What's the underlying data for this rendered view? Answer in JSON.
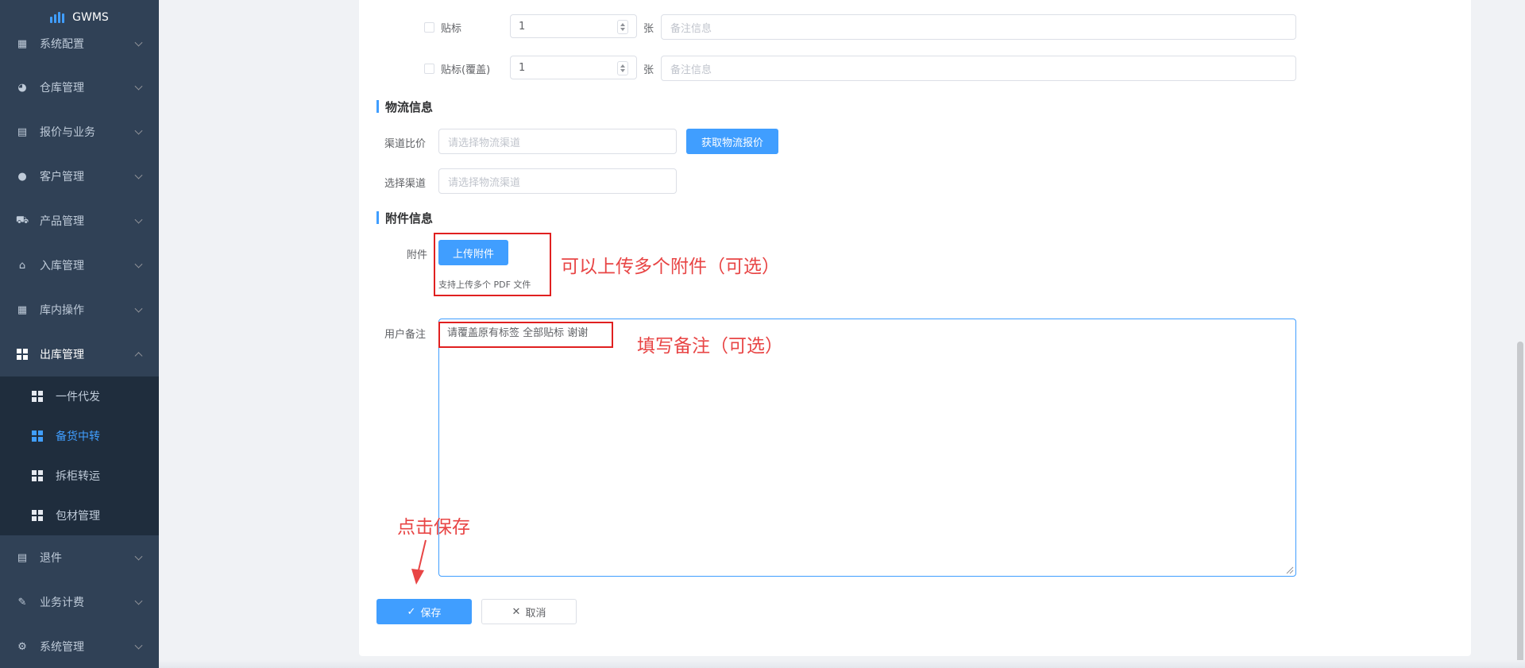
{
  "app": {
    "title": "GWMS"
  },
  "sidebar": {
    "items": [
      {
        "label": "系统配置",
        "icon": "settings-panel-icon"
      },
      {
        "label": "仓库管理",
        "icon": "globe-icon"
      },
      {
        "label": "报价与业务",
        "icon": "document-icon"
      },
      {
        "label": "客户管理",
        "icon": "user-icon"
      },
      {
        "label": "产品管理",
        "icon": "cart-icon"
      },
      {
        "label": "入库管理",
        "icon": "home-icon"
      },
      {
        "label": "库内操作",
        "icon": "table-icon"
      },
      {
        "label": "出库管理",
        "icon": "grid-icon"
      }
    ],
    "outbound_sub": [
      {
        "label": "一件代发"
      },
      {
        "label": "备货中转"
      },
      {
        "label": "拆柜转运"
      },
      {
        "label": "包材管理"
      }
    ],
    "bottom_items": [
      {
        "label": "退件"
      },
      {
        "label": "业务计费"
      },
      {
        "label": "系统管理"
      }
    ]
  },
  "form": {
    "label_row1": "贴标",
    "label_row1_qty": "1",
    "label_row2": "贴标(覆盖)",
    "label_row2_qty": "1",
    "unit": "张",
    "remark_placeholder": "备注信息",
    "logistics_section": "物流信息",
    "channel_compare_label": "渠道比价",
    "channel_placeholder": "请选择物流渠道",
    "get_quote_button": "获取物流报价",
    "select_channel_label": "选择渠道",
    "attachment_section": "附件信息",
    "attachment_label": "附件",
    "upload_button": "上传附件",
    "upload_hint": "支持上传多个 PDF 文件",
    "user_remark_label": "用户备注",
    "user_remark_value": "请覆盖原有标签 全部贴标 谢谢",
    "save_button": "保存",
    "cancel_button": "取消"
  },
  "annotations": {
    "upload_note": "可以上传多个附件（可选）",
    "remark_note": "填写备注（可选）",
    "save_note": "点击保存",
    "color": "#e84545"
  },
  "colors": {
    "primary": "#409eff",
    "sidebar_bg": "#304156",
    "submenu_bg": "#1f2d3d"
  }
}
